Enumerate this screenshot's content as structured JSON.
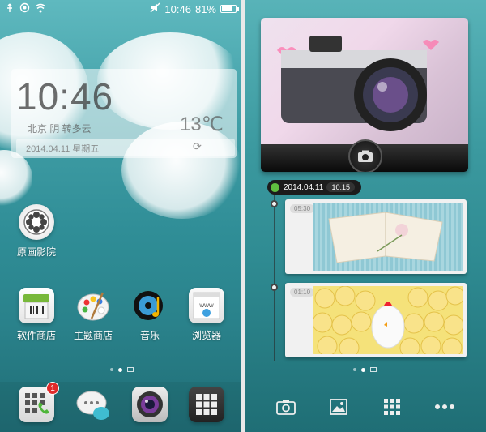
{
  "left_screen": {
    "status_bar": {
      "time": "10:46",
      "battery": "81%",
      "battery_level": 0.81
    },
    "weather_widget": {
      "time": "10:46",
      "location": "北京 阴 转多云",
      "temperature": "13℃",
      "date": "2014.04.11 星期五"
    },
    "apps": [
      {
        "label": "原画影院",
        "icon": "film-reel-icon"
      },
      {
        "label": "软件商店",
        "icon": "app-store-icon"
      },
      {
        "label": "主题商店",
        "icon": "theme-palette-icon"
      },
      {
        "label": "音乐",
        "icon": "music-disc-icon"
      },
      {
        "label": "浏览器",
        "icon": "browser-www-icon"
      }
    ],
    "dock": [
      {
        "icon": "dialer-icon",
        "badge": "1"
      },
      {
        "icon": "messages-icon"
      },
      {
        "icon": "camera-lens-icon"
      },
      {
        "icon": "app-drawer-icon"
      }
    ],
    "page_indicator": {
      "pages": 2,
      "current": 2
    }
  },
  "right_screen": {
    "timeline": {
      "date": "2014.04.11",
      "time": "10:15",
      "entries": [
        {
          "time": "05:30",
          "subject": "open book with flower"
        },
        {
          "time": "01:10",
          "subject": "yellow chicks"
        }
      ]
    },
    "page_indicator": {
      "pages": 2,
      "current": 1
    },
    "toolbar": [
      {
        "icon": "camera-icon"
      },
      {
        "icon": "gallery-icon"
      },
      {
        "icon": "grid-icon"
      },
      {
        "icon": "more-icon"
      }
    ]
  }
}
